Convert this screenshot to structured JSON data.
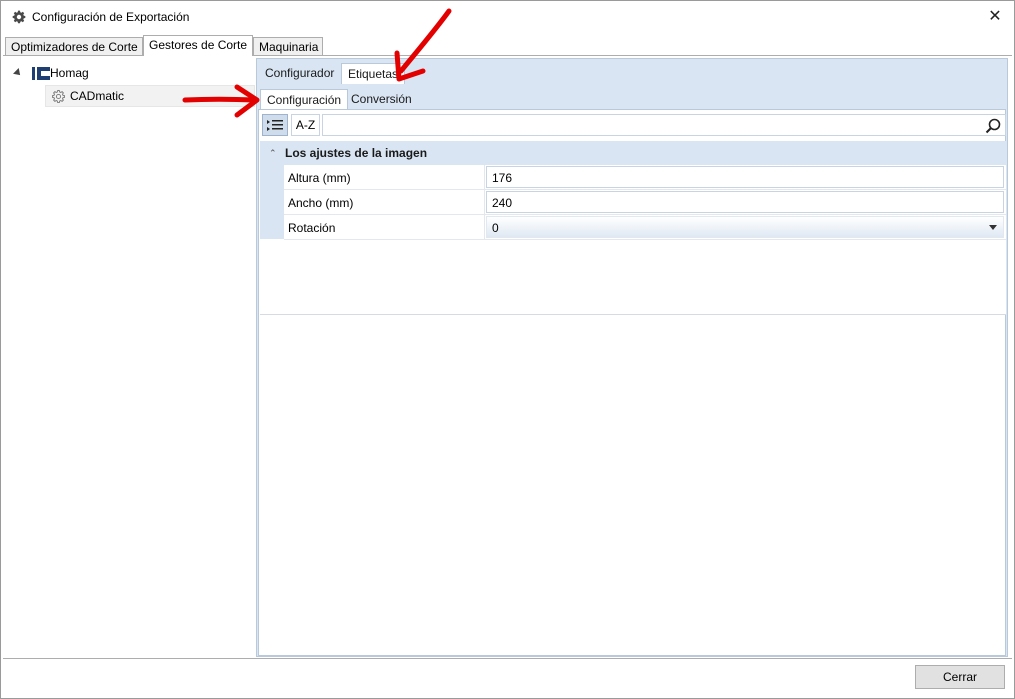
{
  "window": {
    "title": "Configuración de Exportación",
    "close_glyph": "✕"
  },
  "main_tabs": [
    {
      "label": "Optimizadores de Corte"
    },
    {
      "label": "Gestores de Corte"
    },
    {
      "label": "Maquinaria"
    }
  ],
  "tree": {
    "root": {
      "label": "Homag",
      "icon": "homag-logo-icon"
    },
    "child": {
      "label": "CADmatic",
      "icon": "gear-icon"
    }
  },
  "sub_tabs": [
    {
      "label": "Configurador"
    },
    {
      "label": "Etiquetas"
    }
  ],
  "inner_tabs": [
    {
      "label": "Configuración"
    },
    {
      "label": "Conversión"
    }
  ],
  "toolbar": {
    "categorized_icon": "categorized-list-icon",
    "alpha_label": "A-Z",
    "search_icon": "search-icon"
  },
  "grid": {
    "category": "Los ajustes de la imagen",
    "properties": [
      {
        "name": "Altura (mm)",
        "value": "176"
      },
      {
        "name": "Ancho (mm)",
        "value": "240"
      },
      {
        "name": "Rotación",
        "value": "0"
      }
    ]
  },
  "footer": {
    "close_label": "Cerrar"
  },
  "colors": {
    "accent_panel": "#d9e5f3",
    "annotation_arrow": "#e30000"
  }
}
